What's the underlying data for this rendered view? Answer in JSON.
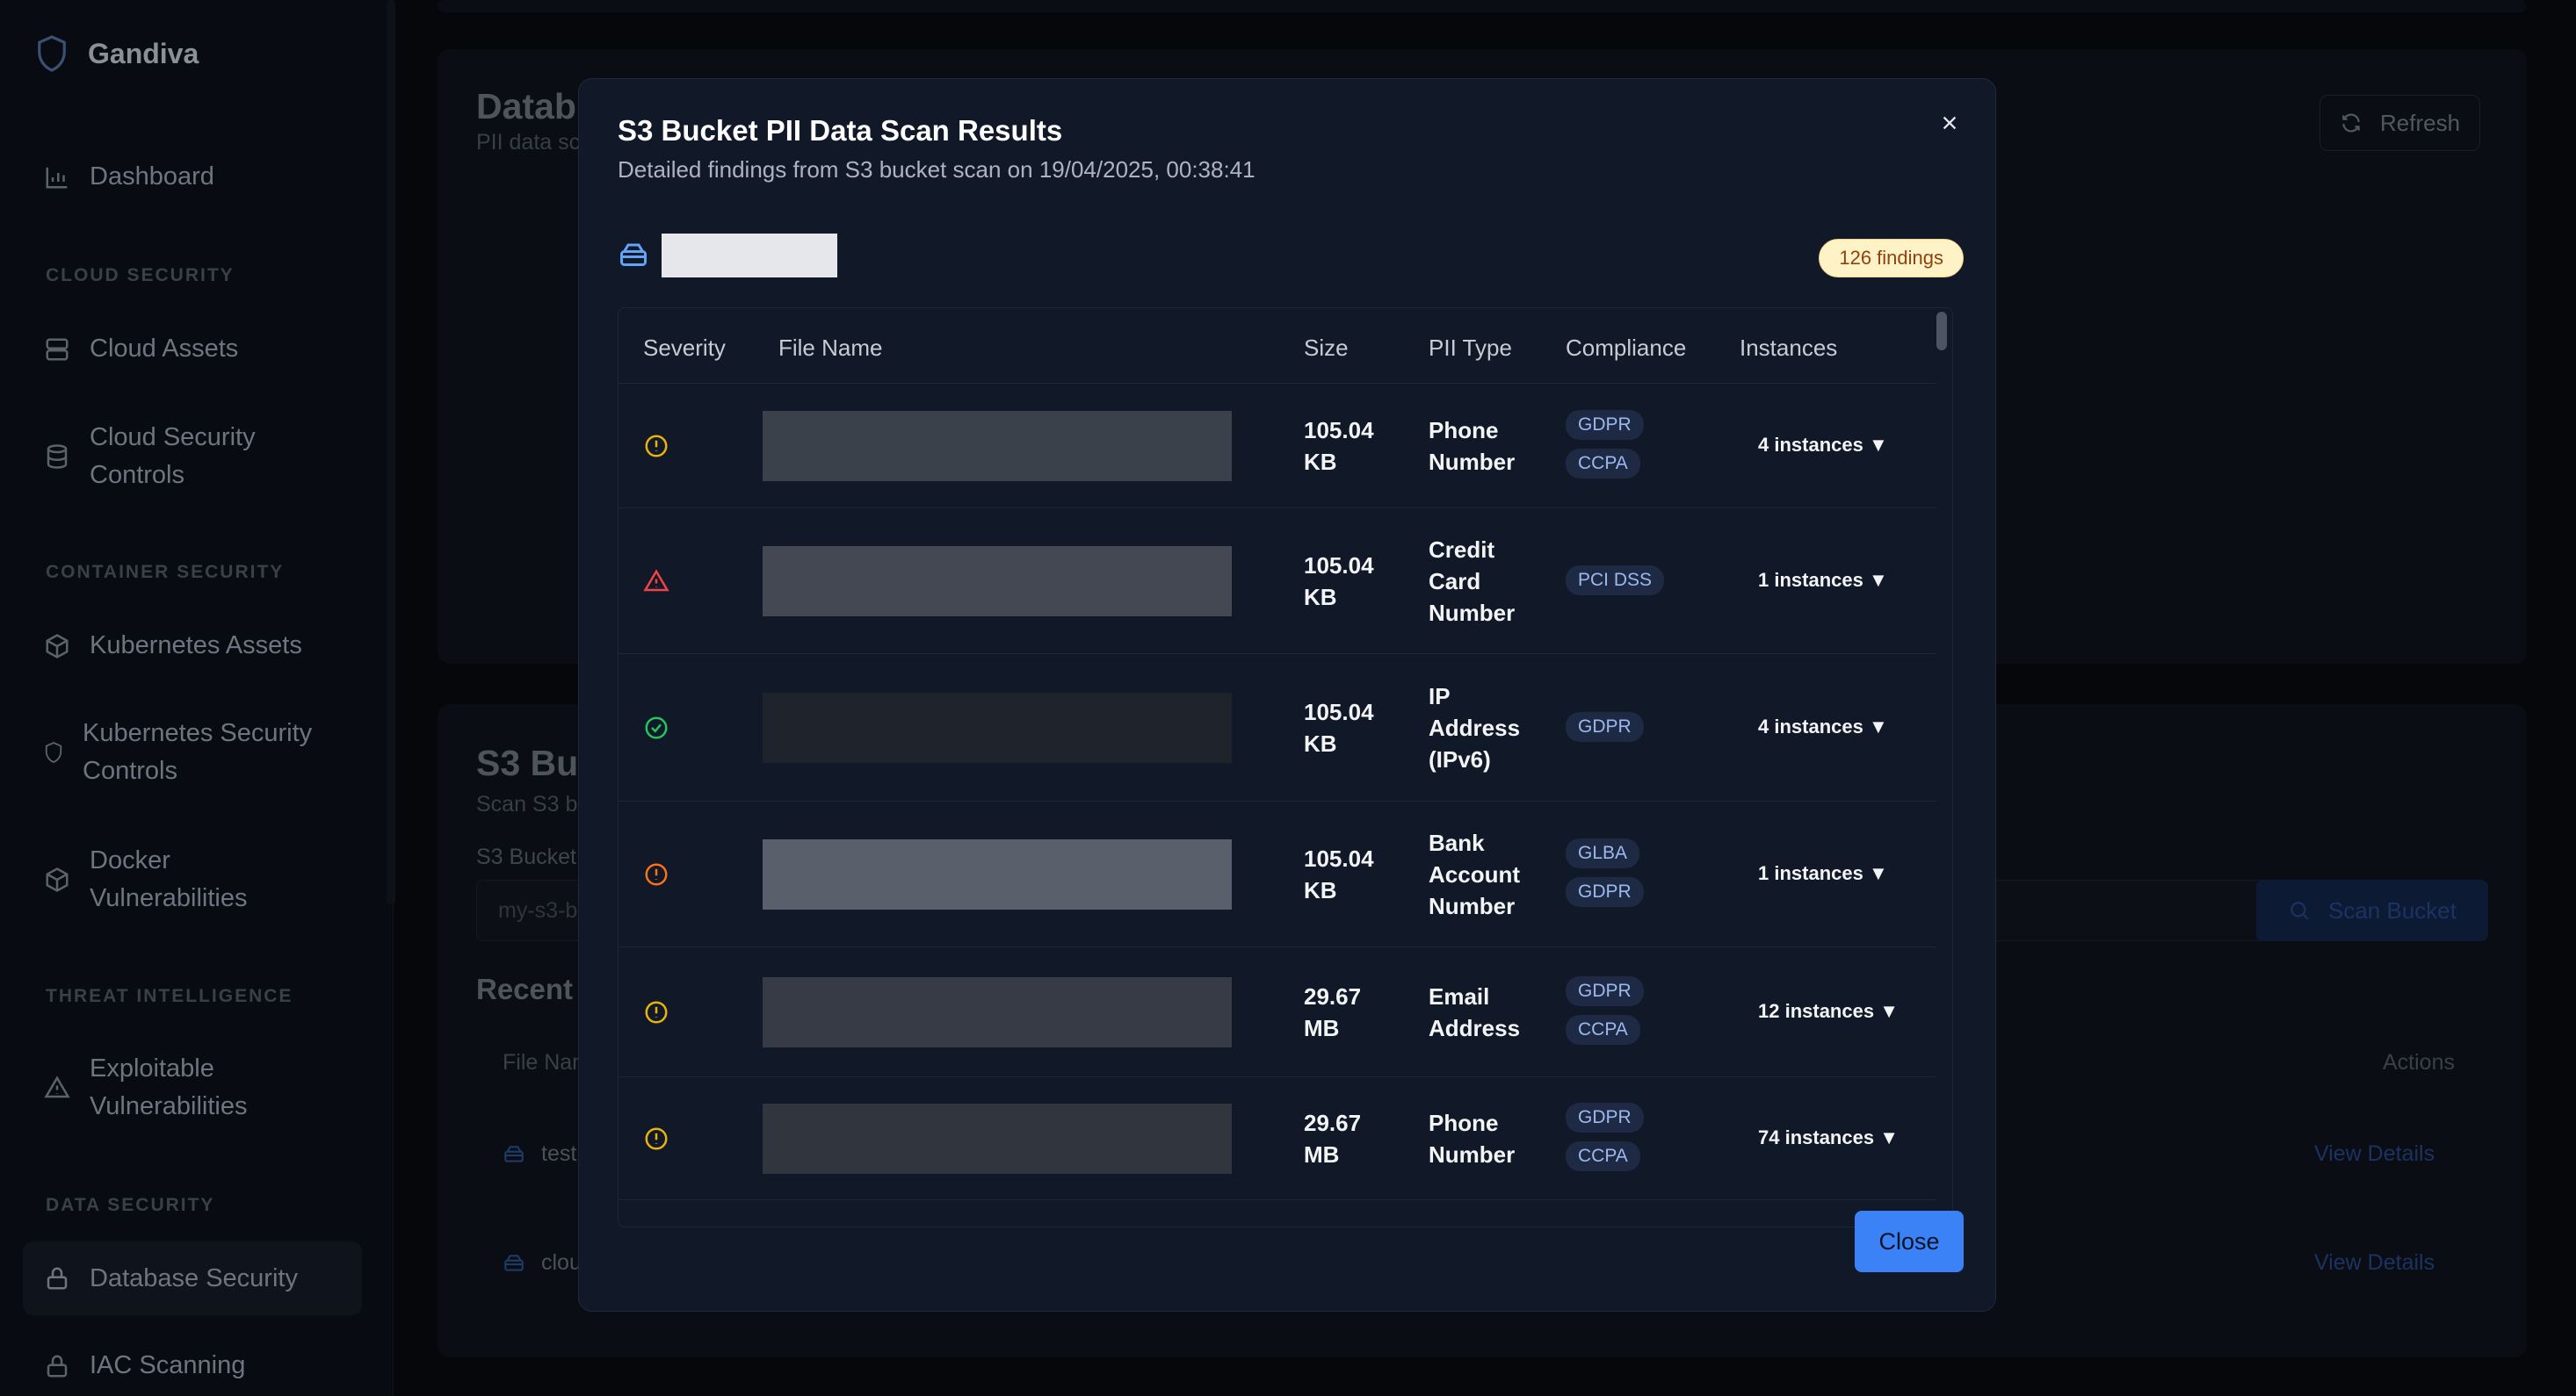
{
  "app": {
    "name": "Gandiva"
  },
  "sidebar": {
    "items": [
      {
        "label": "Dashboard"
      },
      {
        "section": "CLOUD SECURITY"
      },
      {
        "label": "Cloud Assets"
      },
      {
        "label": "Cloud Security",
        "label2": "Controls"
      },
      {
        "section": "CONTAINER SECURITY"
      },
      {
        "label": "Kubernetes Assets"
      },
      {
        "label": "Kubernetes Security",
        "label2": "Controls"
      },
      {
        "label": "Docker",
        "label2": "Vulnerabilities"
      },
      {
        "section": "THREAT INTELLIGENCE"
      },
      {
        "label": "Exploitable",
        "label2": "Vulnerabilities"
      },
      {
        "section": "DATA SECURITY"
      },
      {
        "label": "Database Security"
      },
      {
        "label": "IAC Scanning"
      }
    ]
  },
  "background": {
    "db_title": "Datab",
    "db_sub": "PII data sc",
    "refresh_label": "Refresh",
    "s3_title": "S3 Bu",
    "s3_sub": "Scan S3 b",
    "s3_bucket_label": "S3 Bucket",
    "s3_input_placeholder": "my-s3-b",
    "scan_button": "Scan Bucket",
    "recent_title": "Recent S",
    "col_filename": "File Nam",
    "col_actions": "Actions",
    "rows": [
      {
        "name": "test",
        "action": "View Details"
      },
      {
        "name": "clou",
        "action": "View Details"
      }
    ]
  },
  "modal": {
    "title": "S3 Bucket PII Data Scan Results",
    "description": "Detailed findings from S3 bucket scan on 19/04/2025, 00:38:41",
    "findings_badge": "126 findings",
    "close_label": "Close",
    "columns": [
      "Severity",
      "File Name",
      "Size",
      "PII Type",
      "Compliance",
      "Instances"
    ],
    "rows": [
      {
        "severity": "medium",
        "size": [
          "105.04",
          "KB"
        ],
        "pii_type": [
          "Phone",
          "Number"
        ],
        "compliance": [
          "GDPR",
          "CCPA"
        ],
        "instances": "4 instances ▼"
      },
      {
        "severity": "high",
        "size": [
          "105.04",
          "KB"
        ],
        "pii_type": [
          "Credit",
          "Card",
          "Number"
        ],
        "compliance": [
          "PCI DSS"
        ],
        "instances": "1 instances ▼"
      },
      {
        "severity": "low",
        "size": [
          "105.04",
          "KB"
        ],
        "pii_type": [
          "IP",
          "Address",
          "(IPv6)"
        ],
        "compliance": [
          "GDPR"
        ],
        "instances": "4 instances ▼"
      },
      {
        "severity": "medium-orange",
        "size": [
          "105.04",
          "KB"
        ],
        "pii_type": [
          "Bank",
          "Account",
          "Number"
        ],
        "compliance": [
          "GLBA",
          "GDPR"
        ],
        "instances": "1 instances ▼"
      },
      {
        "severity": "medium",
        "size": [
          "29.67",
          "MB"
        ],
        "pii_type": [
          "Email",
          "Address"
        ],
        "compliance": [
          "GDPR",
          "CCPA"
        ],
        "instances": "12 instances ▼"
      },
      {
        "severity": "medium",
        "size": [
          "29.67",
          "MB"
        ],
        "pii_type": [
          "Phone",
          "Number"
        ],
        "compliance": [
          "GDPR",
          "CCPA"
        ],
        "instances": "74 instances ▼"
      }
    ]
  },
  "colors": {
    "accent": "#3b82f6",
    "severity_medium": "#eab308",
    "severity_high": "#ef4444",
    "severity_low": "#22c55e",
    "severity_medium_orange": "#f97316"
  }
}
